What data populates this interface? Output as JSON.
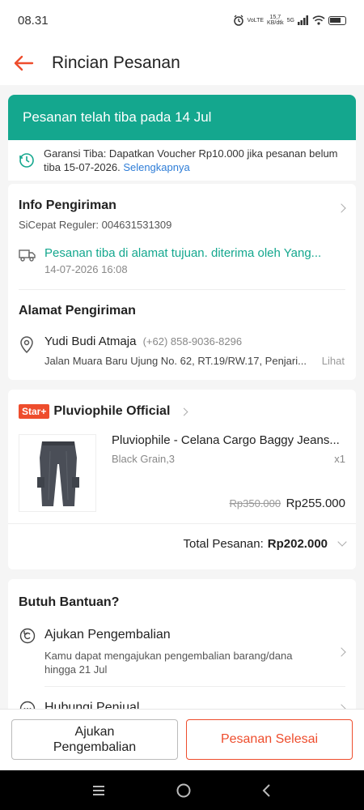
{
  "status_bar": {
    "time": "08.31",
    "volte": "VoLTE",
    "speed": "15,7",
    "speed_unit": "KB/dtk",
    "network": "5G"
  },
  "header": {
    "title": "Rincian Pesanan"
  },
  "banner": {
    "text": "Pesanan telah tiba pada 14 Jul"
  },
  "guarantee": {
    "text": "Garansi Tiba: Dapatkan Voucher Rp10.000 jika pesanan belum tiba 15-07-2026.",
    "link": "Selengkapnya"
  },
  "shipping": {
    "title": "Info Pengiriman",
    "courier": "SiCepat Reguler: 004631531309",
    "status": "Pesanan tiba di alamat tujuan. diterima oleh Yang...",
    "timestamp": "14-07-2026 16:08"
  },
  "address": {
    "title": "Alamat Pengiriman",
    "name": "Yudi Budi Atmaja",
    "phone": "(+62) 858-9036-8296",
    "line": "Jalan Muara Baru Ujung No. 62, RT.19/RW.17, Penjari...",
    "more": "Lihat"
  },
  "shop": {
    "badge": "Star+",
    "name": "Pluviophile Official"
  },
  "product": {
    "name": "Pluviophile - Celana Cargo Baggy Jeans...",
    "variant": "Black Grain,3",
    "qty": "x1",
    "old_price": "Rp350.000",
    "price": "Rp255.000"
  },
  "total": {
    "label": "Total Pesanan:",
    "value": "Rp202.000"
  },
  "help": {
    "title": "Butuh Bantuan?",
    "return_title": "Ajukan Pengembalian",
    "return_desc": "Kamu dapat mengajukan pengembalian barang/dana hingga 21 Jul",
    "contact_title": "Hubungi Penjual"
  },
  "actions": {
    "return_button": "Ajukan Pengembalian",
    "complete_button": "Pesanan Selesai"
  },
  "colors": {
    "accent": "#ee4d2d",
    "banner": "#14a78e",
    "link": "#2e7dd7"
  }
}
